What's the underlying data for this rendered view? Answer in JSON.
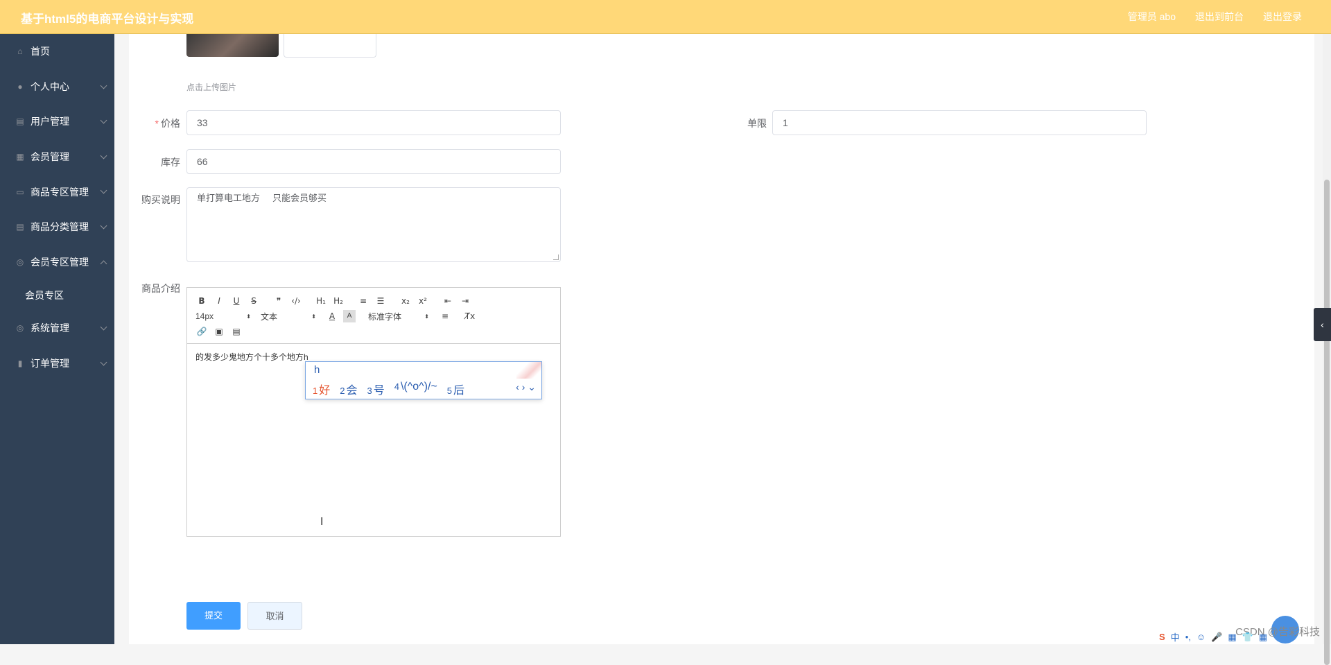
{
  "header": {
    "title": "基于html5的电商平台设计与实现",
    "links": [
      "管理员 abo",
      "退出到前台",
      "退出登录"
    ]
  },
  "sidebar": {
    "items": [
      {
        "label": "首页",
        "icon": "home-icon",
        "glyph": "⌂"
      },
      {
        "label": "个人中心",
        "icon": "user-icon",
        "glyph": "●"
      },
      {
        "label": "用户管理",
        "icon": "clipboard-icon",
        "glyph": "▤"
      },
      {
        "label": "会员管理",
        "icon": "grid-icon",
        "glyph": "▦"
      },
      {
        "label": "商品专区管理",
        "icon": "briefcase-icon",
        "glyph": "▭"
      },
      {
        "label": "商品分类管理",
        "icon": "clipboard-icon",
        "glyph": "▤"
      },
      {
        "label": "会员专区管理",
        "icon": "compass-icon",
        "glyph": "◎"
      },
      {
        "label": "系统管理",
        "icon": "compass-icon",
        "glyph": "◎"
      },
      {
        "label": "订单管理",
        "icon": "bar-chart-icon",
        "glyph": "▮"
      }
    ],
    "submenu": {
      "label": "会员专区"
    }
  },
  "form": {
    "upload_hint": "点击上传图片",
    "price": {
      "label": "价格",
      "value": "33"
    },
    "limit": {
      "label": "单限",
      "value": "1"
    },
    "stock": {
      "label": "库存",
      "value": "66"
    },
    "purchase_note": {
      "label": "购买说明",
      "value": "单打算电工地方     只能会员够买"
    },
    "intro": {
      "label": "商品介绍",
      "content": "的发多少鬼地方个十多个地方h"
    },
    "submit": "提交",
    "cancel": "取消"
  },
  "editor_toolbar": {
    "bold": "B",
    "italic": "I",
    "underline": "U",
    "strike": "S",
    "quote": "❞",
    "code": "‹/›",
    "h1": "H₁",
    "h2": "H₂",
    "ol": "≡",
    "ul": "☰",
    "sub": "x₂",
    "sup": "x²",
    "outdent": "⇤",
    "indent": "⇥",
    "size": "14px",
    "text": "文本",
    "font": "标准字体",
    "color": "A",
    "bg": "A",
    "align": "≡",
    "clean": "T̸x",
    "link": "🔗",
    "image": "▣",
    "video": "▤"
  },
  "ime": {
    "composition": "h",
    "candidates": [
      {
        "n": "1",
        "t": "好"
      },
      {
        "n": "2",
        "t": "会"
      },
      {
        "n": "3",
        "t": "号"
      },
      {
        "n": "4",
        "t": "\\(^o^)/~"
      },
      {
        "n": "5",
        "t": "后"
      }
    ],
    "nav": "‹ › ⌄"
  },
  "watermark": "CSDN @告彩科技",
  "tray": [
    "S",
    "中",
    "•,",
    "☺",
    "🎤",
    "▦",
    "👕",
    "▦"
  ]
}
